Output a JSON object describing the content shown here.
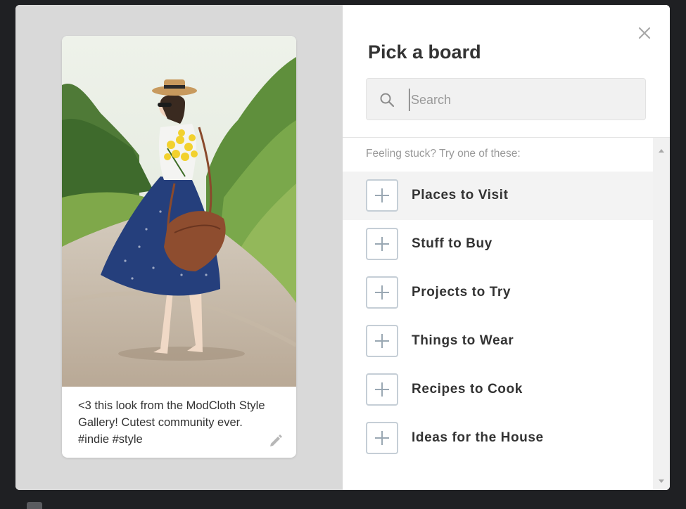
{
  "pin": {
    "description": "<3 this look from the ModCloth Style Gallery! Cutest community ever. #indie #style",
    "image": "woman-in-blue-polka-dot-skirt-holding-yellow-flowers-on-country-road"
  },
  "board_picker": {
    "title": "Pick a board",
    "search": {
      "placeholder": "Search",
      "value": ""
    },
    "suggestions_header": "Feeling stuck? Try one of these:",
    "boards": [
      {
        "label": "Places to Visit",
        "highlighted": true
      },
      {
        "label": "Stuff to Buy"
      },
      {
        "label": "Projects to Try"
      },
      {
        "label": "Things to Wear"
      },
      {
        "label": "Recipes to Cook"
      },
      {
        "label": "Ideas for the House"
      }
    ]
  },
  "icons": {
    "close": "close-icon",
    "search": "search-icon",
    "edit": "pencil-icon",
    "add": "plus-icon"
  },
  "colors": {
    "highlight_row": "#f3f3f3",
    "preview_background": "#d9d9d9",
    "plus_border": "#c5ced6"
  }
}
